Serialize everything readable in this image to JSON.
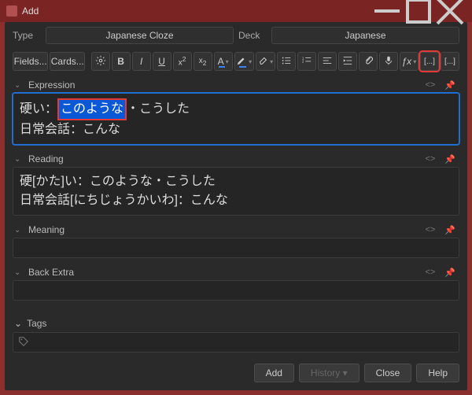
{
  "window": {
    "title": "Add"
  },
  "top": {
    "type_label": "Type",
    "type_value": "Japanese Cloze",
    "deck_label": "Deck",
    "deck_value": "Japanese"
  },
  "toolbar": {
    "fields": "Fields...",
    "cards": "Cards...",
    "fx": "ƒx",
    "cloze1": "[...]",
    "cloze2": "[...]"
  },
  "fields": [
    {
      "name": "Expression",
      "focused": true,
      "content": {
        "line1_pre": "硬い：",
        "line1_sel": "このような",
        "line1_post": "・こうした",
        "line2": "日常会話：こんな"
      }
    },
    {
      "name": "Reading",
      "focused": false,
      "content": {
        "line1": "硬[かた]い：このような・こうした",
        "line2": "日常会話[にちじょうかいわ]：こんな"
      }
    },
    {
      "name": "Meaning",
      "focused": false,
      "content": {}
    },
    {
      "name": "Back Extra",
      "focused": false,
      "content": {}
    }
  ],
  "tags": {
    "label": "Tags"
  },
  "buttons": {
    "add": "Add",
    "history": "History ▾",
    "close": "Close",
    "help": "Help"
  }
}
